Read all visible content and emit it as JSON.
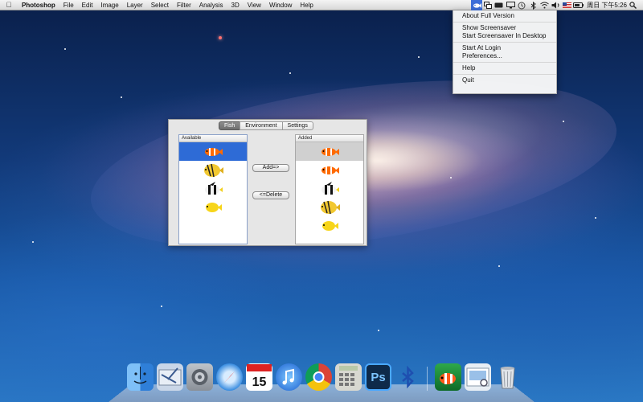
{
  "menubar": {
    "apple_icon": "apple-logo-icon",
    "items": [
      "Photoshop",
      "File",
      "Edit",
      "Image",
      "Layer",
      "Select",
      "Filter",
      "Analysis",
      "3D",
      "View",
      "Window",
      "Help"
    ],
    "status_icons": [
      "fish-app-icon",
      "screens-icon",
      "battery-indicator-icon",
      "display-icon",
      "time-machine-icon",
      "bluetooth-icon",
      "wifi-icon",
      "volume-icon",
      "flag-us-icon",
      "battery-icon"
    ],
    "clock": "周日 下午5:26",
    "search_icon": "spotlight-icon"
  },
  "dropdown": {
    "groups": [
      [
        "About Full Version"
      ],
      [
        "Show Screensaver",
        "Start Screensaver In Desktop"
      ],
      [
        "Start At Login",
        "Preferences..."
      ],
      [
        "Help"
      ],
      [
        "Quit"
      ]
    ]
  },
  "prefs": {
    "tabs": [
      "Fish",
      "Environment",
      "Settings"
    ],
    "selected_tab": "Fish",
    "available_label": "Available",
    "added_label": "Added",
    "add_button": "Add=>",
    "delete_button": "<=Delete",
    "available": [
      "clownfish",
      "butterflyfish",
      "moorish-idol",
      "yellow-tang"
    ],
    "added": [
      "clownfish",
      "clownfish",
      "moorish-idol",
      "butterflyfish",
      "yellow-tang"
    ]
  },
  "dock": {
    "apps": [
      "finder",
      "mail",
      "system-preferences",
      "safari",
      "calendar",
      "itunes",
      "chrome",
      "calculator",
      "photoshop",
      "bluetooth",
      "aquarium",
      "preview",
      "trash"
    ],
    "calendar_day": "15",
    "photoshop_label": "Ps"
  }
}
